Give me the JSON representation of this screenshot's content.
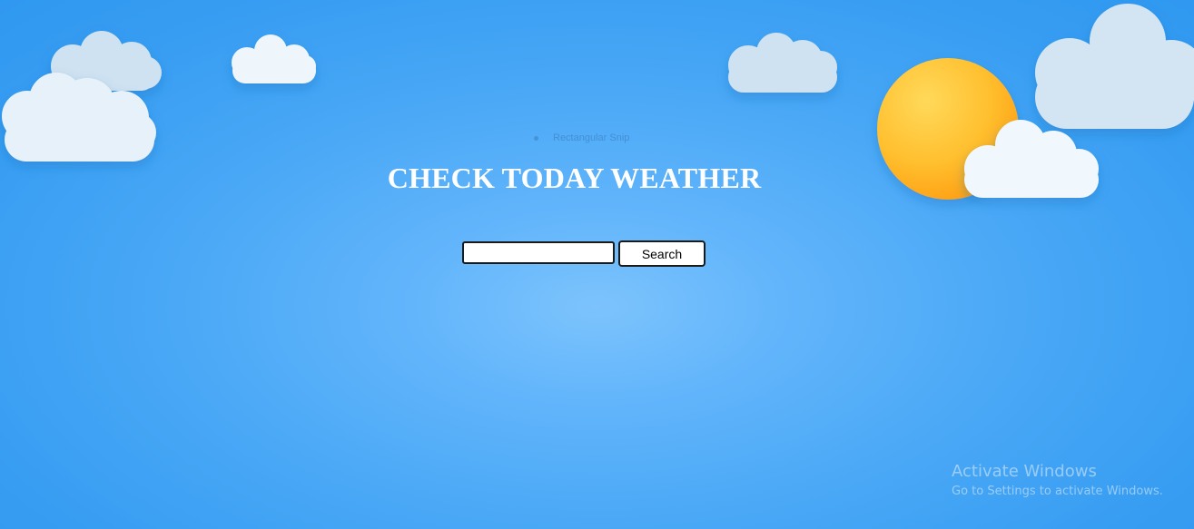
{
  "page": {
    "title": "CHECK TODAY WEATHER"
  },
  "search": {
    "value": "",
    "placeholder": "",
    "button_label": "Search"
  },
  "overlay": {
    "snip_label": "Rectangular Snip"
  },
  "watermark": {
    "title": "Activate Windows",
    "subtitle": "Go to Settings to activate Windows."
  },
  "icons": {
    "sun": "sun-icon",
    "cloud": "cloud-icon"
  },
  "colors": {
    "sky_center": "#7cc3fd",
    "sky_edge": "#2f98f0",
    "sun_light": "#ffd54f",
    "sun_dark": "#ffa41b",
    "cloud": "#eef6fc",
    "title_text": "#ffffff"
  }
}
